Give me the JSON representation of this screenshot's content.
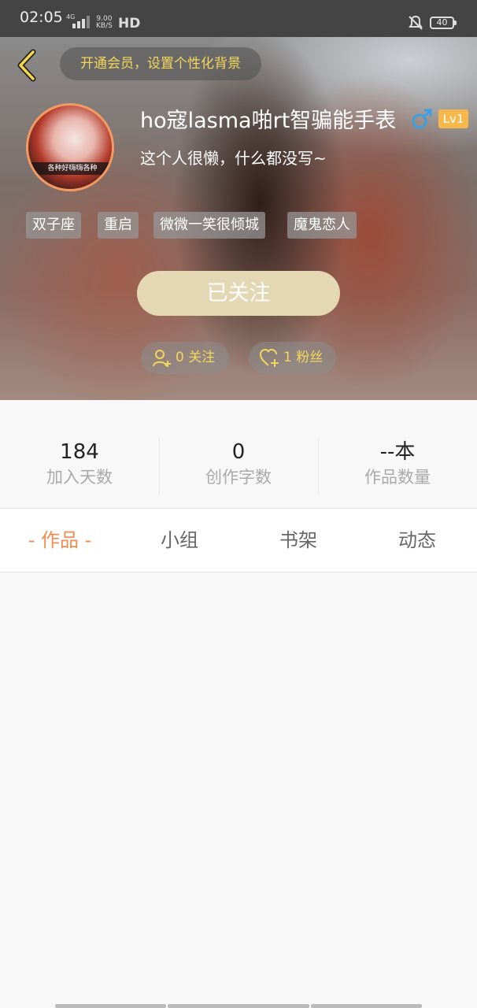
{
  "status_bar": {
    "time": "02:05",
    "network": "4G",
    "speed_value": "9.00",
    "speed_unit": "KB/S",
    "hd": "HD",
    "battery": "40"
  },
  "header": {
    "vip_banner": "开通会员，设置个性化背景"
  },
  "profile": {
    "avatar_text": "各种好嗨嗨各种",
    "name": "ho寇lasma啪rt智骗能手表",
    "level": "Lv1",
    "bio": "这个人很懒，什么都没写~",
    "tags": [
      "双子座",
      "重启",
      "微微一笑很倾城",
      "魔鬼恋人"
    ],
    "follow_button": "已关注",
    "following": "0 关注",
    "fans": "1 粉丝"
  },
  "stats": [
    {
      "value": "184",
      "label": "加入天数"
    },
    {
      "value": "0",
      "label": "创作字数"
    },
    {
      "value": "--本",
      "label": "作品数量"
    }
  ],
  "tabs": [
    {
      "label": "- 作品 -",
      "active": true
    },
    {
      "label": "小组",
      "active": false
    },
    {
      "label": "书架",
      "active": false
    },
    {
      "label": "动态",
      "active": false
    }
  ],
  "colors": {
    "accent": "#ef8c52",
    "gold": "#f3d75a",
    "level_badge": "#f6b84a",
    "follow_button": "#e4d7b4",
    "gender_male": "#3a9fe0"
  },
  "icons": {
    "back": "chevron-left-icon",
    "gender": "male-icon",
    "following": "add-user-icon",
    "fans": "heart-plus-icon"
  }
}
